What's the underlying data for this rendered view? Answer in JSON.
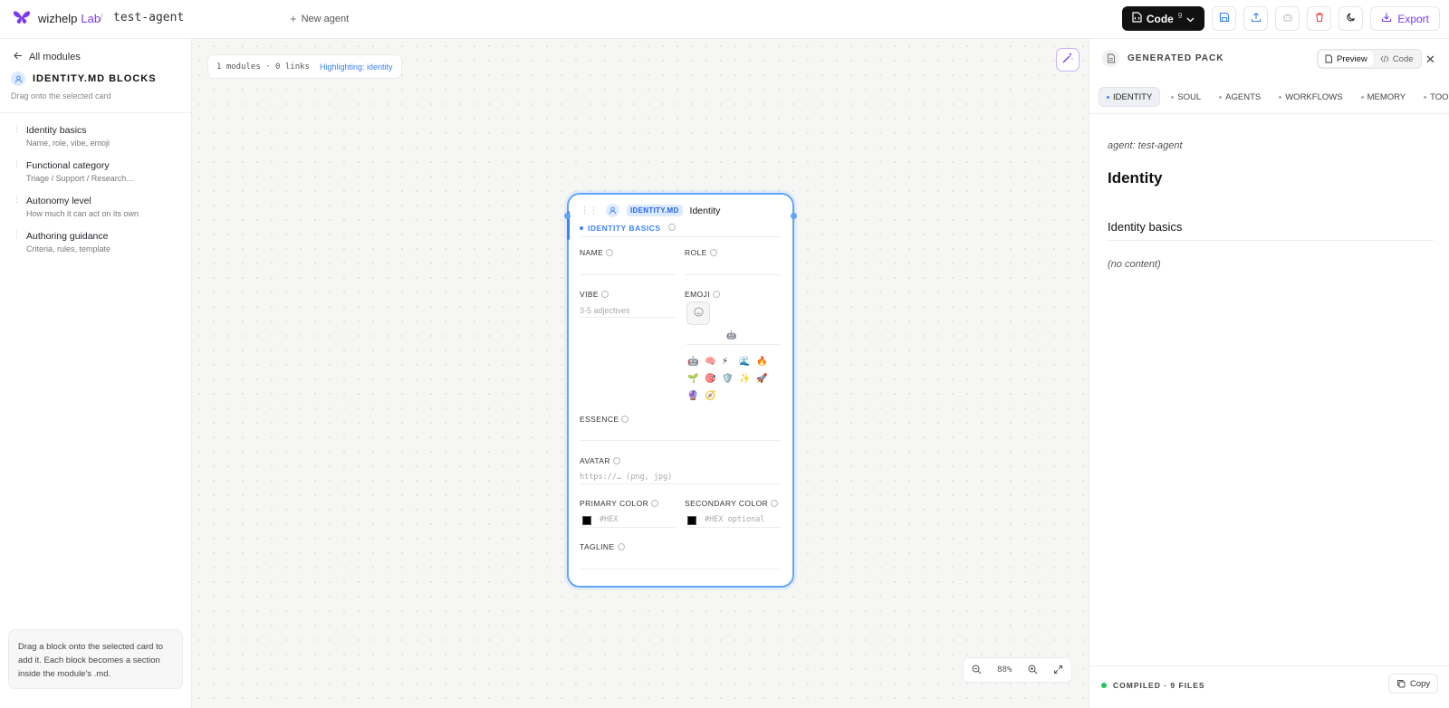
{
  "topbar": {
    "brand_name": "wizhelp",
    "brand_suffix": "Lab",
    "separator": "/",
    "agent_name": "test-agent",
    "new_agent_label": "New agent",
    "code_label": "Code",
    "code_count": "9",
    "export_label": "Export",
    "accent_color": "#7c3aed"
  },
  "sidebar": {
    "back_label": "All modules",
    "title": "IDENTITY.MD BLOCKS",
    "subtitle": "Drag onto the selected card",
    "blocks": [
      {
        "title": "Identity basics",
        "desc": "Name, role, vibe, emoji"
      },
      {
        "title": "Functional category",
        "desc": "Triage / Support / Research…"
      },
      {
        "title": "Autonomy level",
        "desc": "How much it can act on its own"
      },
      {
        "title": "Authoring guidance",
        "desc": "Criteria, rules, template"
      }
    ],
    "hint": "Drag a block onto the selected card to add it. Each block becomes a section inside the module's .md."
  },
  "canvas": {
    "stats": "1 modules · 0 links",
    "highlight": "Highlighting: identity",
    "zoom": "88%"
  },
  "card": {
    "tag": "IDENTITY.MD",
    "title": "Identity",
    "section": "IDENTITY BASICS",
    "fields": {
      "name": "NAME",
      "role": "ROLE",
      "vibe": "VIBE",
      "vibe_placeholder": "3-5 adjectives",
      "emoji": "EMOJI",
      "essence": "ESSENCE",
      "avatar": "AVATAR",
      "avatar_placeholder": "https://… (png, jpg)",
      "primary_color": "PRIMARY COLOR",
      "primary_placeholder": "#HEX",
      "secondary_color": "SECONDARY COLOR",
      "secondary_placeholder": "#HEX optional",
      "tagline": "TAGLINE"
    },
    "emoji_selected": "🤖",
    "emoji_options": [
      "🤖",
      "🧠",
      "⚡",
      "🌊",
      "🔥",
      "🌱",
      "🎯",
      "🛡️",
      "✨",
      "🚀",
      "🔮",
      "🧭"
    ],
    "border_color": "#60a5fa"
  },
  "panel": {
    "title": "GENERATED PACK",
    "preview_label": "Preview",
    "code_label": "Code",
    "tabs": [
      "IDENTITY",
      "SOUL",
      "AGENTS",
      "WORKFLOWS",
      "MEMORY",
      "TOOLS"
    ],
    "active_tab": "IDENTITY",
    "doc": {
      "meta": "agent: test-agent",
      "h1": "Identity",
      "h2": "Identity basics",
      "empty": "(no content)"
    },
    "footer_status": "COMPILED · 9 FILES",
    "copy_label": "Copy",
    "status_color": "#22c55e"
  }
}
